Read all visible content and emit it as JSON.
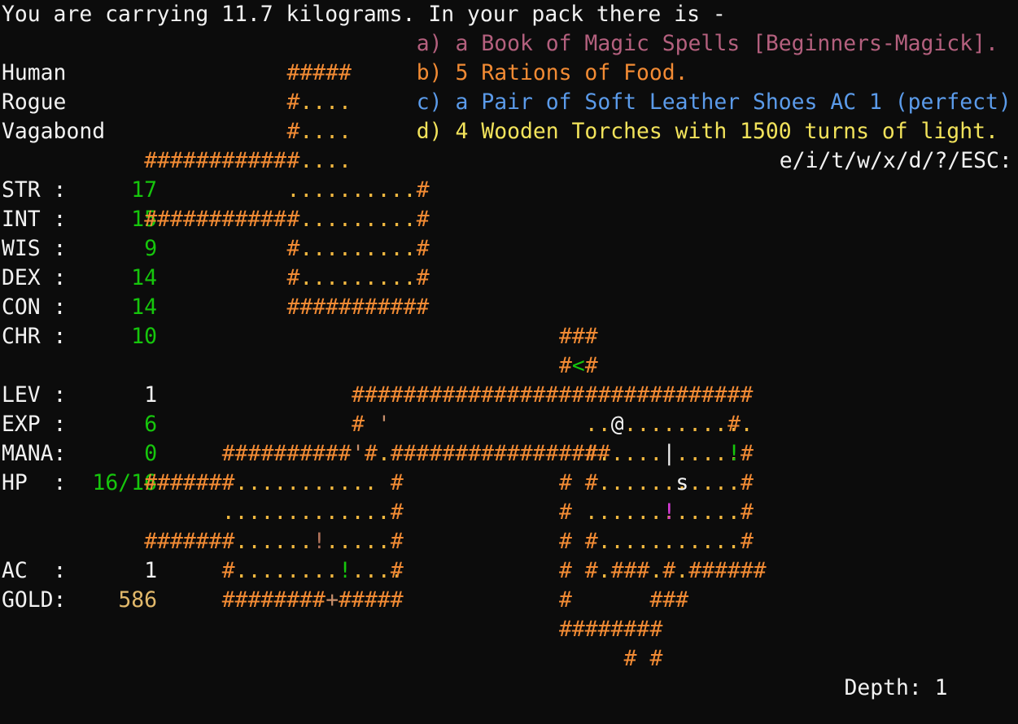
{
  "header": {
    "message": "You are carrying 11.7 kilograms. In your pack there is -",
    "prompt": "e/i/t/w/x/d/?/ESC:"
  },
  "inventory": [
    {
      "letter": "a)",
      "text": "a Book of Magic Spells [Beginners-Magick].",
      "color": "#b4607e"
    },
    {
      "letter": "b)",
      "text": "5 Rations of Food.",
      "color": "#f28b34"
    },
    {
      "letter": "c)",
      "text": "a Pair of Soft Leather Shoes AC 1 (perfect)",
      "color": "#5b9bea"
    },
    {
      "letter": "d)",
      "text": "4 Wooden Torches with 1500 turns of light.",
      "color": "#f2e35b"
    }
  ],
  "character": {
    "race": "Human",
    "class": "Rogue",
    "title": "Vagabond"
  },
  "stats": [
    {
      "label": "STR :",
      "value": "17",
      "color": "#16c60c"
    },
    {
      "label": "INT :",
      "value": "15",
      "color": "#16c60c"
    },
    {
      "label": "WIS :",
      "value": "9",
      "color": "#16c60c"
    },
    {
      "label": "DEX :",
      "value": "14",
      "color": "#16c60c"
    },
    {
      "label": "CON :",
      "value": "14",
      "color": "#16c60c"
    },
    {
      "label": "CHR :",
      "value": "10",
      "color": "#16c60c"
    }
  ],
  "status": [
    {
      "label": "LEV :",
      "value": "1",
      "color": "#f2f2f2"
    },
    {
      "label": "EXP :",
      "value": "6",
      "color": "#16c60c"
    },
    {
      "label": "MANA:",
      "value": "0",
      "color": "#16c60c"
    },
    {
      "label": "HP  :",
      "value": "16/16",
      "color": "#16c60c"
    }
  ],
  "armor": {
    "label": "AC  :",
    "value": "1",
    "color": "#f2f2f2"
  },
  "gold": {
    "label": "GOLD:",
    "value": "586",
    "color": "#e2b96b"
  },
  "depth": "Depth: 1",
  "colors": {
    "background": "#0c0c0c",
    "text": "#f2f2f2",
    "wall": "#f28b34",
    "floor": "#f2b840",
    "stat_value": "#16c60c",
    "gold": "#e2b96b",
    "door_open": "#c78f6b",
    "potion_green": "#16c60c",
    "potion_magenta": "#d63bd6",
    "potion_brown": "#b0725a",
    "stairs_up": "#16c60c",
    "player": "#f2f2f2",
    "monster": "#f2f2f2",
    "staff": "#f2f2f2"
  },
  "map": [
    {
      "line": 2,
      "segs": [
        [
          22,
          "#####",
          "wall"
        ]
      ]
    },
    {
      "line": 3,
      "segs": [
        [
          22,
          "#",
          "wall"
        ],
        [
          23,
          "....",
          "floor"
        ]
      ]
    },
    {
      "line": 4,
      "segs": [
        [
          22,
          "#",
          "wall"
        ],
        [
          23,
          "....",
          "floor"
        ]
      ]
    },
    {
      "line": 5,
      "segs": [
        [
          11,
          "###########",
          "wall"
        ],
        [
          22,
          "#",
          "wall"
        ],
        [
          23,
          "....",
          "floor"
        ]
      ]
    },
    {
      "line": 6,
      "segs": [
        [
          22,
          "..........",
          "floor"
        ],
        [
          32,
          "#",
          "wall"
        ]
      ]
    },
    {
      "line": 7,
      "segs": [
        [
          11,
          "###########",
          "wall"
        ],
        [
          22,
          "#",
          "wall"
        ],
        [
          23,
          ".........",
          "floor"
        ],
        [
          32,
          "#",
          "wall"
        ]
      ]
    },
    {
      "line": 8,
      "segs": [
        [
          22,
          "#",
          "wall"
        ],
        [
          23,
          ".........",
          "floor"
        ],
        [
          32,
          "#",
          "wall"
        ]
      ]
    },
    {
      "line": 9,
      "segs": [
        [
          22,
          "#",
          "wall"
        ],
        [
          23,
          ".........",
          "floor"
        ],
        [
          32,
          "#",
          "wall"
        ]
      ]
    },
    {
      "line": 10,
      "segs": [
        [
          22,
          "###########",
          "wall"
        ]
      ]
    },
    {
      "line": 11,
      "segs": [
        [
          43,
          "###",
          "wall"
        ]
      ]
    },
    {
      "line": 12,
      "segs": [
        [
          43,
          "#",
          "wall"
        ],
        [
          44,
          "<",
          "stairs_up"
        ],
        [
          45,
          "#",
          "wall"
        ]
      ]
    },
    {
      "line": 13,
      "segs": [
        [
          27,
          "##################",
          "wall"
        ],
        [
          45,
          "#############",
          "wall"
        ]
      ]
    },
    {
      "line": 14,
      "segs": [
        [
          27,
          "#",
          "wall"
        ],
        [
          29,
          "'",
          "door_open"
        ],
        [
          45,
          "..",
          "floor"
        ],
        [
          47,
          "@",
          "player"
        ],
        [
          48,
          "..........",
          "floor"
        ],
        [
          56,
          "#",
          "wall"
        ]
      ]
    },
    {
      "line": 15,
      "segs": [
        [
          17,
          "##########",
          "wall"
        ],
        [
          27,
          "'",
          "door_open"
        ],
        [
          28,
          "#",
          "wall"
        ],
        [
          29,
          ".",
          "floor"
        ],
        [
          30,
          "#################",
          "wall"
        ],
        [
          45,
          "#",
          "wall"
        ],
        [
          46,
          ".....",
          "floor"
        ],
        [
          51,
          "|",
          "staff"
        ],
        [
          52,
          ".....",
          "floor"
        ],
        [
          56,
          "!",
          "potion_green"
        ],
        [
          57,
          "#",
          "wall"
        ]
      ]
    },
    {
      "line": 16,
      "segs": [
        [
          11,
          "#######",
          "wall"
        ],
        [
          18,
          "...........",
          "floor"
        ],
        [
          30,
          "#",
          "wall"
        ],
        [
          43,
          "#",
          "wall"
        ],
        [
          45,
          "#",
          "wall"
        ],
        [
          46,
          ".......",
          "floor"
        ],
        [
          52,
          "s",
          "monster"
        ],
        [
          53,
          "....",
          "floor"
        ],
        [
          57,
          "#",
          "wall"
        ]
      ]
    },
    {
      "line": 17,
      "segs": [
        [
          17,
          ".............",
          "floor"
        ],
        [
          30,
          "#",
          "wall"
        ],
        [
          43,
          "#",
          "wall"
        ],
        [
          45,
          ".......",
          "floor"
        ],
        [
          51,
          "!",
          "potion_magenta"
        ],
        [
          52,
          ".....",
          "floor"
        ],
        [
          57,
          "#",
          "wall"
        ]
      ]
    },
    {
      "line": 18,
      "segs": [
        [
          11,
          "#######",
          "wall"
        ],
        [
          18,
          "......",
          "floor"
        ],
        [
          24,
          "!",
          "potion_brown"
        ],
        [
          25,
          ".....",
          "floor"
        ],
        [
          30,
          "#",
          "wall"
        ],
        [
          43,
          "#",
          "wall"
        ],
        [
          45,
          "#",
          "wall"
        ],
        [
          46,
          "...........",
          "floor"
        ],
        [
          57,
          "#",
          "wall"
        ]
      ]
    },
    {
      "line": 19,
      "segs": [
        [
          17,
          "#",
          "wall"
        ],
        [
          18,
          "........",
          "floor"
        ],
        [
          26,
          "!",
          "potion_green"
        ],
        [
          27,
          "....",
          "floor"
        ],
        [
          30,
          "#",
          "wall"
        ],
        [
          43,
          "#",
          "wall"
        ],
        [
          45,
          "#",
          "wall"
        ],
        [
          46,
          ".",
          "floor"
        ],
        [
          47,
          "###",
          "wall"
        ],
        [
          50,
          ".",
          "floor"
        ],
        [
          51,
          "#",
          "wall"
        ],
        [
          52,
          ".",
          "floor"
        ],
        [
          53,
          "######",
          "wall"
        ]
      ]
    },
    {
      "line": 20,
      "segs": [
        [
          17,
          "########",
          "wall"
        ],
        [
          25,
          "+",
          "door_open"
        ],
        [
          26,
          "#####",
          "wall"
        ],
        [
          43,
          "#",
          "wall"
        ],
        [
          50,
          "###",
          "wall"
        ]
      ]
    },
    {
      "line": 21,
      "segs": [
        [
          43,
          "#######",
          "wall"
        ],
        [
          50,
          "#",
          "wall"
        ]
      ]
    },
    {
      "line": 22,
      "segs": [
        [
          48,
          "#",
          "wall"
        ],
        [
          50,
          "#",
          "wall"
        ]
      ]
    }
  ]
}
